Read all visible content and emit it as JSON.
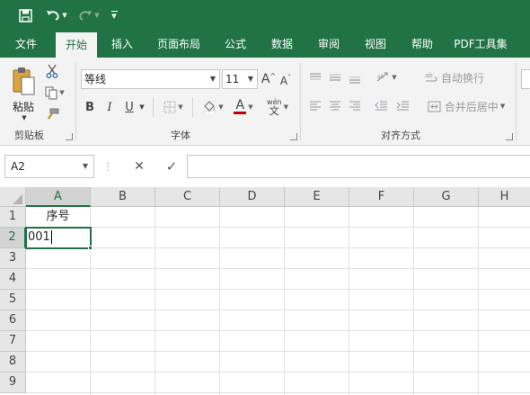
{
  "quick_access": {
    "save_icon": "save-icon",
    "undo_icon": "undo-icon",
    "redo_icon": "redo-icon",
    "customize_icon": "customize-toolbar-icon"
  },
  "tabs": [
    {
      "label": "文件",
      "active": false
    },
    {
      "label": "开始",
      "active": true
    },
    {
      "label": "插入",
      "active": false
    },
    {
      "label": "页面布局",
      "active": false
    },
    {
      "label": "公式",
      "active": false
    },
    {
      "label": "数据",
      "active": false
    },
    {
      "label": "审阅",
      "active": false
    },
    {
      "label": "视图",
      "active": false
    },
    {
      "label": "帮助",
      "active": false
    },
    {
      "label": "PDF工具集",
      "active": false
    }
  ],
  "ribbon": {
    "clipboard": {
      "group_label": "剪贴板",
      "paste_label": "粘贴"
    },
    "font": {
      "group_label": "字体",
      "font_name": "等线",
      "font_size": "11",
      "bold": "B",
      "italic": "I",
      "underline": "U",
      "font_color_glyph": "A",
      "phonetic_top": "wén",
      "phonetic_bottom": "文"
    },
    "alignment": {
      "group_label": "对齐方式",
      "wrap_text": "自动换行",
      "merge_center": "合并后居中"
    }
  },
  "formula_bar": {
    "name_box": "A2",
    "cancel_glyph": "✕",
    "enter_glyph": "✓",
    "formula": ""
  },
  "sheet": {
    "columns": [
      "A",
      "B",
      "C",
      "D",
      "E",
      "F",
      "G",
      "H"
    ],
    "rows": [
      "1",
      "2",
      "3",
      "4",
      "5",
      "6",
      "7",
      "8",
      "9"
    ],
    "cells": {
      "A1": "序号",
      "A2": "001"
    },
    "active_cell": "A2"
  },
  "colors": {
    "brand": "#217346",
    "ribbon_bg": "#f3f3f3",
    "font_color_bar": "#c00000"
  }
}
